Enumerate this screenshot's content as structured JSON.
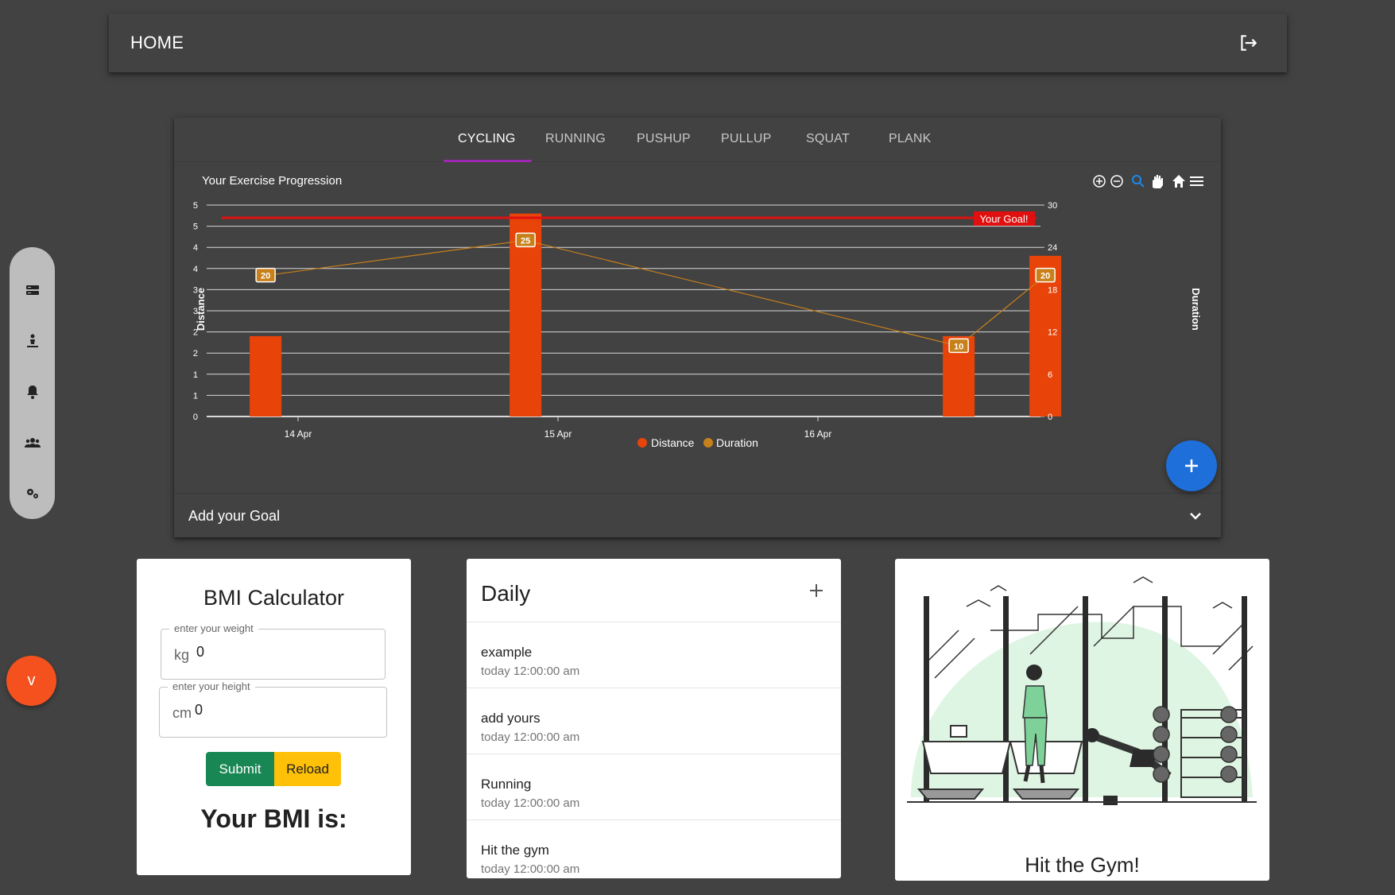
{
  "header": {
    "title": "HOME",
    "logout_icon": "logout-icon"
  },
  "rail": {
    "icons": [
      "dashboard-icon",
      "exercise-icon",
      "notification-bell-icon",
      "group-icon",
      "settings-icon"
    ]
  },
  "toggle_button": {
    "label": "v"
  },
  "tabs": [
    {
      "label": "CYCLING",
      "active": true
    },
    {
      "label": "RUNNING",
      "active": false
    },
    {
      "label": "PUSHUP",
      "active": false
    },
    {
      "label": "PULLUP",
      "active": false
    },
    {
      "label": "SQUAT",
      "active": false
    },
    {
      "label": "PLANK",
      "active": false
    }
  ],
  "chart_data": {
    "type": "bar",
    "title": "Your Exercise Progression",
    "y_left_label": "Distance",
    "y_right_label": "Duration",
    "y_left_ticks": [
      "0",
      "1",
      "1",
      "2",
      "2",
      "3",
      "3",
      "4",
      "4",
      "5",
      "5"
    ],
    "y_left_range": [
      0,
      5
    ],
    "y_right_ticks": [
      "0",
      "6",
      "12",
      "18",
      "24",
      "30"
    ],
    "y_right_range": [
      0,
      30
    ],
    "x_ticks": [
      "14 Apr",
      "15 Apr",
      "16 Apr"
    ],
    "series": [
      {
        "name": "Distance",
        "color": "#e8440a",
        "type": "bar",
        "points": [
          {
            "x": "2024-04-13T21:00",
            "y": 1.9
          },
          {
            "x": "2024-04-14T21:00",
            "y": 4.8
          },
          {
            "x": "2024-04-16T13:00",
            "y": 1.9
          },
          {
            "x": "2024-04-16T21:00",
            "y": 3.8
          }
        ]
      },
      {
        "name": "Duration",
        "color": "#c8801a",
        "type": "line",
        "points": [
          {
            "x": "2024-04-13T21:00",
            "y": 20,
            "label": "20"
          },
          {
            "x": "2024-04-14T21:00",
            "y": 25,
            "label": "25"
          },
          {
            "x": "2024-04-16T13:00",
            "y": 10,
            "label": "10"
          },
          {
            "x": "2024-04-16T21:00",
            "y": 20,
            "label": "20"
          }
        ]
      }
    ],
    "goal": {
      "label": "Your Goal!",
      "y": 4.7,
      "color": "#e01010"
    },
    "legend": [
      "Distance",
      "Duration"
    ],
    "legend_position": "bottom-center",
    "toolbar_icons": [
      "zoom-in-icon",
      "zoom-out-icon",
      "selection-zoom-icon",
      "pan-icon",
      "reset-home-icon",
      "menu-icon"
    ]
  },
  "add_goal": {
    "label": "Add your Goal"
  },
  "bmi": {
    "title": "BMI Calculator",
    "weight": {
      "legend": "enter your weight",
      "unit": "kg",
      "value": "0"
    },
    "height": {
      "legend": "enter your height",
      "unit": "cm",
      "value": "0"
    },
    "submit_label": "Submit",
    "reload_label": "Reload",
    "result_label": "Your BMI is:"
  },
  "daily": {
    "title": "Daily",
    "items": [
      {
        "name": "example",
        "time": "today 12:00:00 am"
      },
      {
        "name": "add yours",
        "time": "today 12:00:00 am"
      },
      {
        "name": "Running",
        "time": "today 12:00:00 am"
      },
      {
        "name": "Hit the gym",
        "time": "today 12:00:00 am"
      }
    ]
  },
  "gym": {
    "caption": "Hit the Gym!"
  }
}
